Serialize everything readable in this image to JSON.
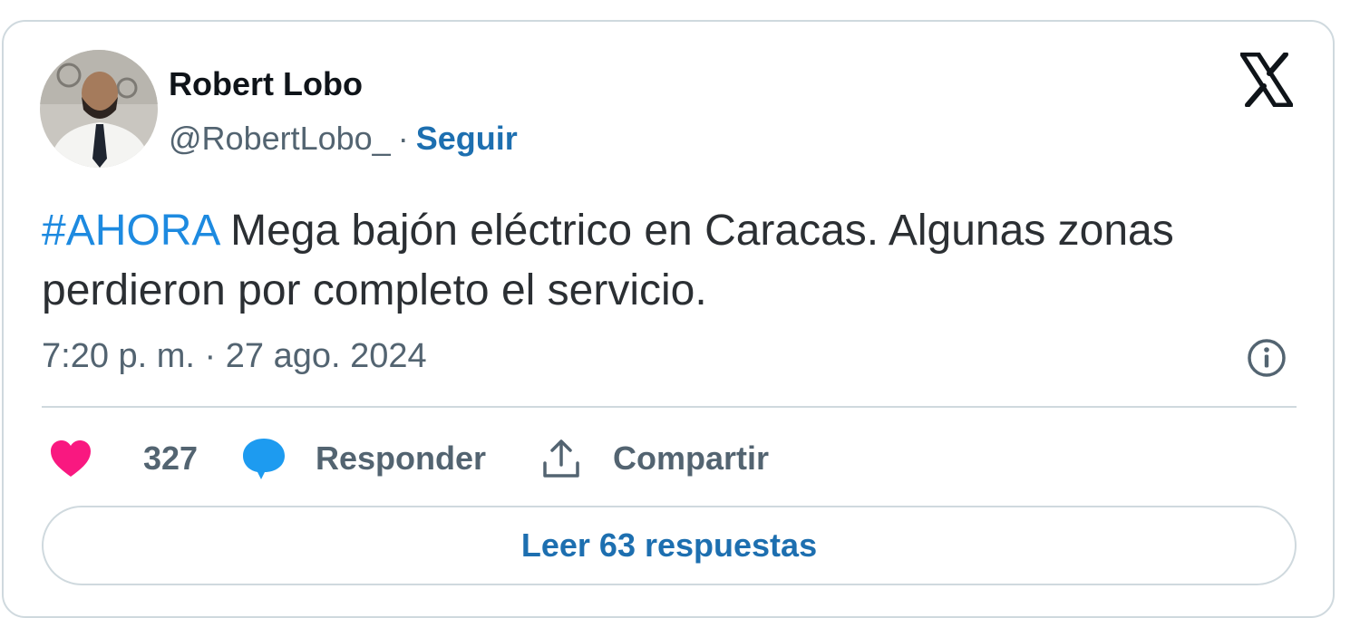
{
  "author": {
    "name": "Robert Lobo",
    "handle": "@RobertLobo_",
    "separator": "·",
    "follow_label": "Seguir"
  },
  "platform": {
    "logo_icon": "x-logo-icon"
  },
  "tweet": {
    "hashtag": "#AHORA",
    "text": " Mega bajón eléctrico en Caracas. Algunas zonas perdieron por completo el servicio.",
    "timestamp": "7:20 p. m. · 27 ago. 2024"
  },
  "actions": {
    "like_count": "327",
    "reply_label": "Responder",
    "share_label": "Compartir"
  },
  "footer": {
    "read_replies_label": "Leer 63 respuestas"
  },
  "colors": {
    "link": "#1d6fb0",
    "hashtag": "#1d8ae0",
    "heart": "#f91880",
    "reply_bubble": "#1d9bf0",
    "border": "#cfd9de",
    "secondary_text": "#536471"
  }
}
